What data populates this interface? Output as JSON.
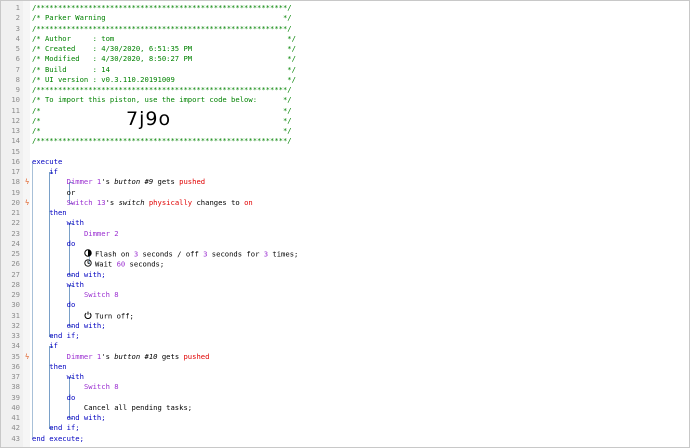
{
  "lines": [
    {
      "n": "1",
      "parts": [
        {
          "t": "/**********************************************************/",
          "k": "c"
        }
      ]
    },
    {
      "n": "2",
      "parts": [
        {
          "t": "/* Parker Warning                                         */",
          "k": "c"
        }
      ]
    },
    {
      "n": "3",
      "parts": [
        {
          "t": "/**********************************************************/",
          "k": "c"
        }
      ]
    },
    {
      "n": "4",
      "parts": [
        {
          "t": "/* Author     : tom                                        */",
          "k": "c"
        }
      ]
    },
    {
      "n": "5",
      "parts": [
        {
          "t": "/* Created    : 4/30/2020, 6:51:35 PM                      */",
          "k": "c"
        }
      ]
    },
    {
      "n": "6",
      "parts": [
        {
          "t": "/* Modified   : 4/30/2020, 8:50:27 PM                      */",
          "k": "c"
        }
      ]
    },
    {
      "n": "7",
      "parts": [
        {
          "t": "/* Build      : 14                                         */",
          "k": "c"
        }
      ]
    },
    {
      "n": "8",
      "parts": [
        {
          "t": "/* UI version : v0.3.110.20191009                          */",
          "k": "c"
        }
      ]
    },
    {
      "n": "9",
      "parts": [
        {
          "t": "/**********************************************************/",
          "k": "c"
        }
      ]
    },
    {
      "n": "10",
      "parts": [
        {
          "t": "/* To import this piston, use the import code below:      */",
          "k": "c"
        }
      ]
    },
    {
      "n": "11",
      "parts": [
        {
          "t": "/*                                                        */",
          "k": "c"
        }
      ]
    },
    {
      "n": "12",
      "parts": [
        {
          "t": "/*                                                        */",
          "k": "c"
        }
      ]
    },
    {
      "n": "13",
      "parts": [
        {
          "t": "/*                                                        */",
          "k": "c"
        }
      ]
    },
    {
      "n": "14",
      "parts": [
        {
          "t": "/**********************************************************/",
          "k": "c"
        }
      ]
    },
    {
      "n": "15",
      "parts": []
    },
    {
      "n": "16",
      "parts": [
        {
          "t": "execute",
          "k": "kw"
        }
      ]
    },
    {
      "n": "17",
      "parts": [
        {
          "t": "    if",
          "k": "kw"
        }
      ]
    },
    {
      "n": "18",
      "flag": true,
      "parts": [
        {
          "t": "        ",
          "k": "txt"
        },
        {
          "t": "Dimmer 1",
          "k": "dev"
        },
        {
          "t": "'s ",
          "k": "txt"
        },
        {
          "t": "button #9",
          "k": "ev"
        },
        {
          "t": " gets ",
          "k": "txt"
        },
        {
          "t": "pushed",
          "k": "val"
        }
      ]
    },
    {
      "n": "19",
      "parts": [
        {
          "t": "        or",
          "k": "txt"
        }
      ]
    },
    {
      "n": "20",
      "flag": true,
      "parts": [
        {
          "t": "        ",
          "k": "txt"
        },
        {
          "t": "Switch 13",
          "k": "dev"
        },
        {
          "t": "'s ",
          "k": "txt"
        },
        {
          "t": "switch",
          "k": "ev"
        },
        {
          "t": " ",
          "k": "txt"
        },
        {
          "t": "physically",
          "k": "val"
        },
        {
          "t": " changes to ",
          "k": "txt"
        },
        {
          "t": "on",
          "k": "val"
        }
      ]
    },
    {
      "n": "21",
      "parts": [
        {
          "t": "    then",
          "k": "kw"
        }
      ]
    },
    {
      "n": "22",
      "parts": [
        {
          "t": "        with",
          "k": "kw"
        }
      ]
    },
    {
      "n": "23",
      "parts": [
        {
          "t": "            ",
          "k": "txt"
        },
        {
          "t": "Dimmer 2",
          "k": "dev"
        }
      ]
    },
    {
      "n": "24",
      "parts": [
        {
          "t": "        do",
          "k": "kw"
        }
      ]
    },
    {
      "n": "25",
      "icon": "flash-icon",
      "parts": [
        {
          "t": "            ",
          "k": "txt"
        },
        {
          "t": "Flash on ",
          "k": "txt"
        },
        {
          "t": "3",
          "k": "dev"
        },
        {
          "t": " seconds / off ",
          "k": "txt"
        },
        {
          "t": "3",
          "k": "dev"
        },
        {
          "t": " seconds for ",
          "k": "txt"
        },
        {
          "t": "3",
          "k": "dev"
        },
        {
          "t": " times;",
          "k": "txt"
        }
      ]
    },
    {
      "n": "26",
      "icon": "clock-icon",
      "parts": [
        {
          "t": "            ",
          "k": "txt"
        },
        {
          "t": "Wait ",
          "k": "txt"
        },
        {
          "t": "60",
          "k": "dev"
        },
        {
          "t": " seconds;",
          "k": "txt"
        }
      ]
    },
    {
      "n": "27",
      "parts": [
        {
          "t": "        end with;",
          "k": "kw"
        }
      ]
    },
    {
      "n": "28",
      "parts": [
        {
          "t": "        with",
          "k": "kw"
        }
      ]
    },
    {
      "n": "29",
      "parts": [
        {
          "t": "            ",
          "k": "txt"
        },
        {
          "t": "Switch 8",
          "k": "dev"
        }
      ]
    },
    {
      "n": "30",
      "parts": [
        {
          "t": "        do",
          "k": "kw"
        }
      ]
    },
    {
      "n": "31",
      "icon": "power-icon",
      "parts": [
        {
          "t": "            ",
          "k": "txt"
        },
        {
          "t": "Turn off;",
          "k": "txt"
        }
      ]
    },
    {
      "n": "32",
      "parts": [
        {
          "t": "        end with;",
          "k": "kw"
        }
      ]
    },
    {
      "n": "33",
      "parts": [
        {
          "t": "    end if;",
          "k": "kw"
        }
      ]
    },
    {
      "n": "34",
      "parts": [
        {
          "t": "    if",
          "k": "kw"
        }
      ]
    },
    {
      "n": "35",
      "flag": true,
      "parts": [
        {
          "t": "        ",
          "k": "txt"
        },
        {
          "t": "Dimmer 1",
          "k": "dev"
        },
        {
          "t": "'s ",
          "k": "txt"
        },
        {
          "t": "button #10",
          "k": "ev"
        },
        {
          "t": " gets ",
          "k": "txt"
        },
        {
          "t": "pushed",
          "k": "val"
        }
      ]
    },
    {
      "n": "36",
      "parts": [
        {
          "t": "    then",
          "k": "kw"
        }
      ]
    },
    {
      "n": "37",
      "parts": [
        {
          "t": "        with",
          "k": "kw"
        }
      ]
    },
    {
      "n": "38",
      "parts": [
        {
          "t": "            ",
          "k": "txt"
        },
        {
          "t": "Switch 8",
          "k": "dev"
        }
      ]
    },
    {
      "n": "39",
      "parts": [
        {
          "t": "        do",
          "k": "kw"
        }
      ]
    },
    {
      "n": "40",
      "parts": [
        {
          "t": "            Cancel all pending tasks;",
          "k": "txt"
        }
      ]
    },
    {
      "n": "41",
      "parts": [
        {
          "t": "        end with;",
          "k": "kw"
        }
      ]
    },
    {
      "n": "42",
      "parts": [
        {
          "t": "    end if;",
          "k": "kw"
        }
      ]
    },
    {
      "n": "43",
      "parts": [
        {
          "t": "end execute;",
          "k": "kw"
        }
      ]
    }
  ],
  "import_code": "7j9o",
  "colors": {
    "comment": "#008200",
    "keyword": "#0000c0",
    "device": "#9b2fd1",
    "value": "#e00000",
    "flag": "#e05a1e",
    "guide": "#7aa0c8"
  }
}
